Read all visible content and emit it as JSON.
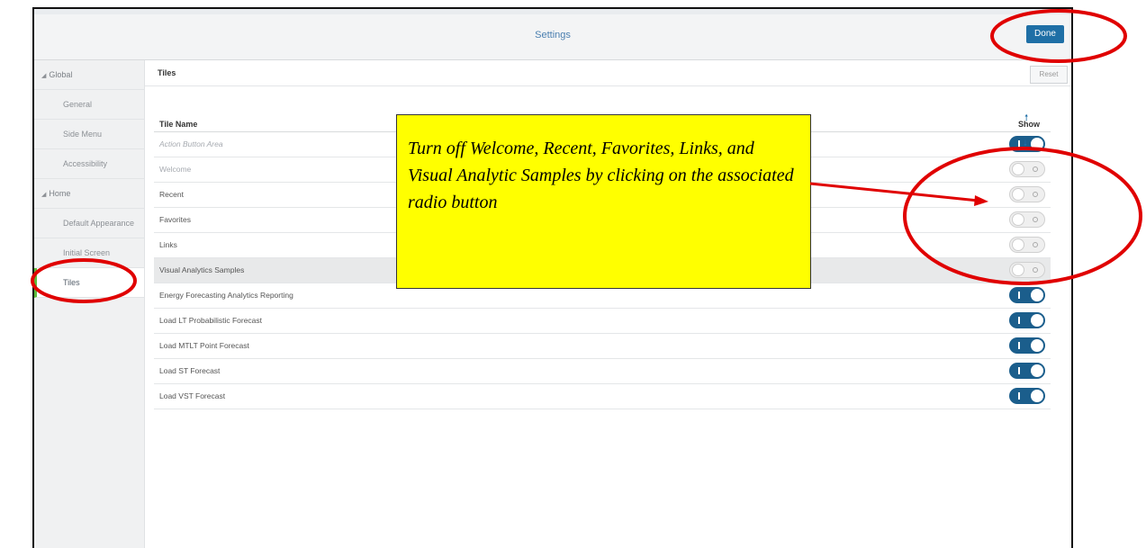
{
  "window": {
    "title": "Settings",
    "done_label": "Done"
  },
  "sidebar": {
    "items": [
      {
        "label": "Global",
        "type": "group"
      },
      {
        "label": "General",
        "type": "sub"
      },
      {
        "label": "Side Menu",
        "type": "sub"
      },
      {
        "label": "Accessibility",
        "type": "sub"
      },
      {
        "label": "Home",
        "type": "group"
      },
      {
        "label": "Default Appearance",
        "type": "sub"
      },
      {
        "label": "Initial Screen",
        "type": "sub"
      },
      {
        "label": "Tiles",
        "type": "sub",
        "active": true
      }
    ]
  },
  "main": {
    "section_title": "Tiles",
    "reset_label": "Reset",
    "columns": {
      "name": "Tile Name",
      "show": "Show"
    },
    "rows": [
      {
        "name": "Action Button Area",
        "show": true
      },
      {
        "name": "Welcome",
        "show": false
      },
      {
        "name": "Recent",
        "show": false
      },
      {
        "name": "Favorites",
        "show": false
      },
      {
        "name": "Links",
        "show": false
      },
      {
        "name": "Visual Analytics Samples",
        "show": false
      },
      {
        "name": "Energy Forecasting Analytics Reporting",
        "show": true
      },
      {
        "name": "Load LT Probabilistic Forecast",
        "show": true
      },
      {
        "name": "Load MTLT Point Forecast",
        "show": true
      },
      {
        "name": "Load ST Forecast",
        "show": true
      },
      {
        "name": "Load VST Forecast",
        "show": true
      }
    ]
  },
  "annotation": {
    "text": "Turn off Welcome, Recent, Favorites, Links, and Visual Analytic Samples by clicking on the associated radio button",
    "callout_color": "#ffff00",
    "marker_color": "#e00000"
  },
  "colors": {
    "accent": "#1f6fa6",
    "active_marker": "#5dbb3b",
    "toggle_on": "#1b5e8c"
  }
}
